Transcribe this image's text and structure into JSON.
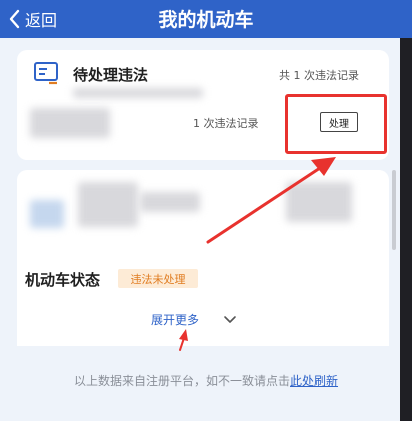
{
  "header": {
    "back_label": "返回",
    "title": "我的机动车"
  },
  "violations": {
    "title": "待处理违法",
    "total_records": "共 1 次违法记录",
    "row_records": "1 次违法记录",
    "handle_label": "处理"
  },
  "vehicle_status": {
    "title": "机动车状态",
    "badge": "违法未处理",
    "expand_label": "展开更多"
  },
  "footer": {
    "note": "以上数据来自注册平台，如不一致请点击",
    "refresh_link": "此处刷新"
  },
  "colors": {
    "brand": "#2f63c8",
    "annotation_red": "#e8322e",
    "badge_text": "#e07d22",
    "badge_bg": "#fdebd6"
  },
  "icons": [
    "back-icon",
    "document-icon",
    "chevron-down-icon"
  ]
}
